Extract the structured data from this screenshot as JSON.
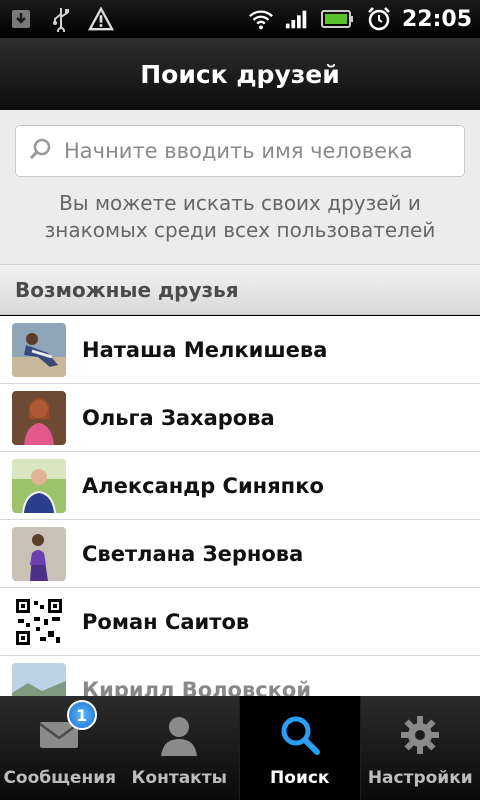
{
  "status_bar": {
    "time": "22:05",
    "icons": [
      "download-icon",
      "usb-icon",
      "warning-icon",
      "wifi-icon",
      "signal-icon",
      "battery-icon",
      "alarm-icon"
    ]
  },
  "header": {
    "title": "Поиск друзей"
  },
  "search": {
    "placeholder": "Начните вводить имя человека",
    "hint_line1": "Вы можете искать своих друзей и",
    "hint_line2": "знакомых среди всех пользователей"
  },
  "suggestions": {
    "title": "Возможные друзья",
    "items": [
      {
        "name": "Наташа Мелкишева"
      },
      {
        "name": "Ольга Захарова"
      },
      {
        "name": "Александр Синяпко"
      },
      {
        "name": "Светлана Зернова"
      },
      {
        "name": "Роман Саитов"
      },
      {
        "name": "Кирилл Воловской"
      }
    ]
  },
  "nav": {
    "tabs": [
      {
        "label": "Сообщения",
        "badge": "1"
      },
      {
        "label": "Контакты"
      },
      {
        "label": "Поиск",
        "active": true
      },
      {
        "label": "Настройки"
      }
    ]
  },
  "colors": {
    "accent": "#2a9df4",
    "badge": "#1a6fcc"
  }
}
